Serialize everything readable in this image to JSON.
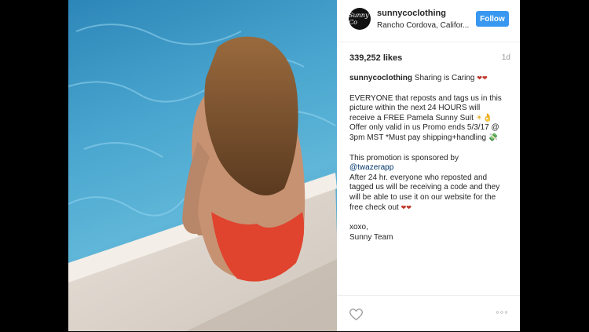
{
  "post": {
    "username": "sunnycoclothing",
    "avatar_text": "Sunny Co",
    "location": "Rancho Cordova, Califor...",
    "follow_label": "Follow",
    "likes": "339,252 likes",
    "time_ago": "1d",
    "more_label": "◦◦◦"
  },
  "caption": {
    "author": "sunnycoclothing",
    "lines": [
      "Sharing is Caring",
      "EVERYONE that reposts and tags us in this",
      "picture within the next 24 HOURS will",
      "receive a FREE Pamela Sunny Suit",
      "Offer only valid in us Promo ends 5/3/17 @",
      "3pm MST *Must pay shipping+handling",
      "This promotion is sponsored by",
      "@twazerapp",
      "After 24 hr. everyone who reposted and",
      "tagged us will be receiving a code and they",
      "will be able to use it on our website for the",
      "free check out",
      "xoxo,",
      "Sunny Team"
    ],
    "emoji": {
      "hearts": "❤❤",
      "sun_hand": "☀👌",
      "money": "💸"
    }
  },
  "colors": {
    "follow_bg": "#3897f0",
    "swimsuit": "#e0442e",
    "pool": "#4aa6cf"
  },
  "icons": {
    "like": "heart-outline-icon",
    "more": "ellipsis-icon"
  }
}
